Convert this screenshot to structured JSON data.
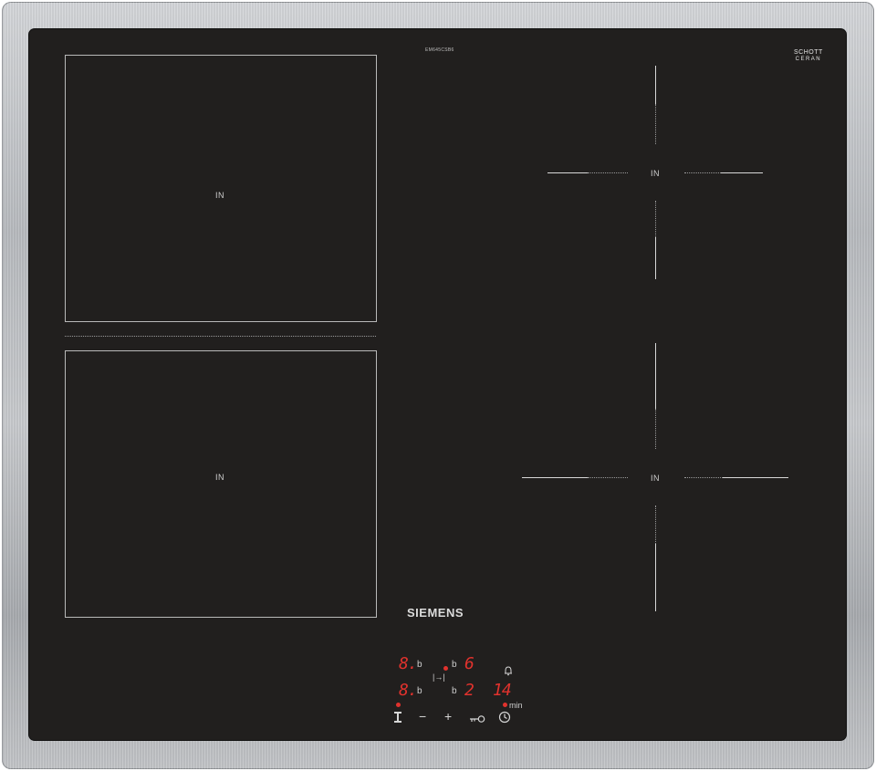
{
  "hob": {
    "model_number": "EM645CSB6",
    "glass_maker": {
      "line1": "SCHOTT",
      "line2": "CERAN",
      "line3": ""
    },
    "brand": "SIEMENS",
    "zones": [
      {
        "label": "IN"
      },
      {
        "label": "IN"
      },
      {
        "label": "IN"
      },
      {
        "label": "IN"
      }
    ],
    "control_panel": {
      "display_top_left": "8.",
      "display_bottom_left": "8.",
      "display_top_right": "6",
      "display_bottom_right": "2",
      "timer_display": "14",
      "residual_heat_letter": "b",
      "timer_unit": "min",
      "minus_symbol": "−",
      "plus_symbol": "+",
      "flex_zone_symbol": "|→|",
      "indicator_color": "#e1322d"
    }
  }
}
